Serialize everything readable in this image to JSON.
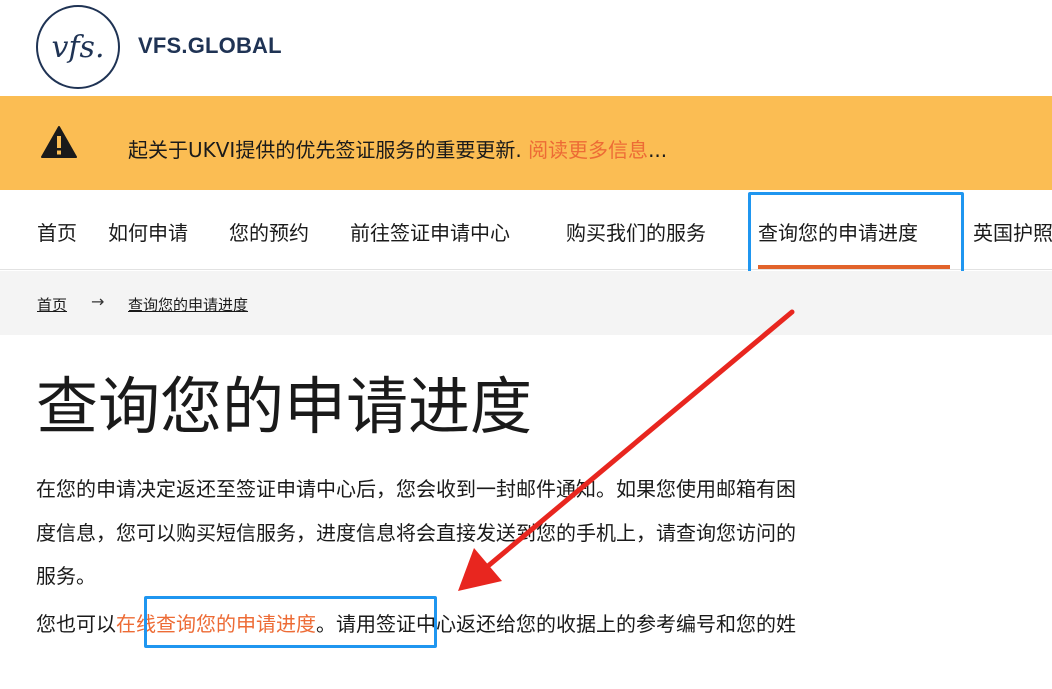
{
  "header": {
    "logo_mark": "vfs.",
    "brand": "VFS.GLOBAL"
  },
  "alert": {
    "text": "起关于UKVI提供的优先签证服务的重要更新. ",
    "link": "阅读更多信息",
    "ellipsis": "..."
  },
  "nav": {
    "items": [
      {
        "label": "首页"
      },
      {
        "label": "如何申请"
      },
      {
        "label": "您的预约"
      },
      {
        "label": "前往签证申请中心"
      },
      {
        "label": "购买我们的服务"
      },
      {
        "label": "查询您的申请进度"
      },
      {
        "label": "英国护照"
      }
    ]
  },
  "breadcrumb": {
    "home": "首页",
    "separator": "→",
    "current": "查询您的申请进度"
  },
  "main": {
    "title": "查询您的申请进度",
    "p1_line1": "在您的申请决定返还至签证申请中心后，您会收到一封邮件通知。如果您使用邮箱有困",
    "p1_line2": "度信息，您可以购买短信服务，进度信息将会直接发送到您的手机上，请查询您访问的",
    "p1_line3": "服务。",
    "p2_before": "您也可以",
    "p2_link": "在线查询您的申请进度",
    "p2_after": "。请用签证中心返还给您的收据上的参考编号和您的姓"
  },
  "colors": {
    "brand_navy": "#1f3354",
    "alert_bg": "#fbbd53",
    "accent_orange": "#ed6b35",
    "highlight_blue": "#1f96f0",
    "arrow_red": "#e8261f"
  }
}
